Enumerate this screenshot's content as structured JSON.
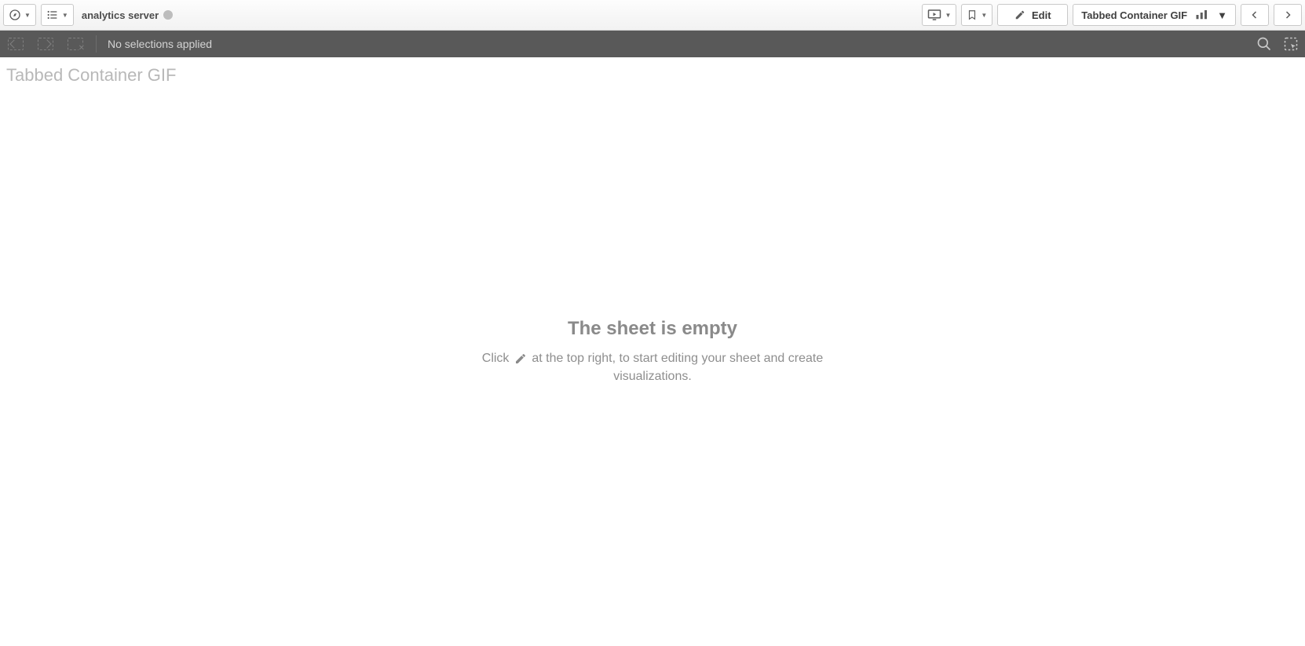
{
  "topbar": {
    "app_name": "analytics server",
    "edit_label": "Edit",
    "sheet_label": "Tabbed Container GIF"
  },
  "selections": {
    "status_text": "No selections applied"
  },
  "sheet": {
    "title": "Tabbed Container GIF"
  },
  "empty": {
    "heading": "The sheet is empty",
    "hint_before": "Click ",
    "hint_after": " at the top right, to start editing your sheet and create visualizations."
  }
}
